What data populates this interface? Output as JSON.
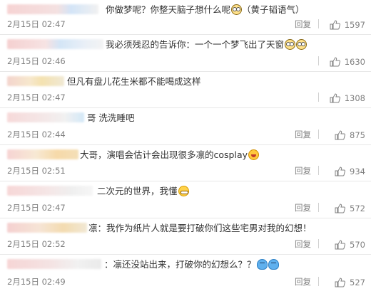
{
  "comments": [
    {
      "text": "你做梦呢？你整天脑子想什么呢",
      "emojis": [
        "glasses-face-icon"
      ],
      "suffix": "（黄子韬语气）",
      "time": "2月15日 02:47",
      "reply": "回复",
      "likes": "1597"
    },
    {
      "text": "我必须残忍的告诉你：一个一个梦飞出了天窗",
      "emojis": [
        "glasses-face-icon",
        "glasses-face-icon"
      ],
      "suffix": "",
      "time": "2月15日 02:46",
      "reply": "回复",
      "likes": "1630"
    },
    {
      "text": "但凡有盘儿花生米都不能喝成这样",
      "emojis": [],
      "suffix": "",
      "time": "2月15日 02:47",
      "reply": "回复",
      "likes": "1308"
    },
    {
      "text": "哥 洗洗睡吧",
      "emojis": [],
      "suffix": "",
      "time": "2月15日 02:44",
      "reply": "回复",
      "likes": "875"
    },
    {
      "text": "大哥，演唱会估计会出现很多凛的cosplay",
      "emojis": [
        "laugh-face-icon"
      ],
      "suffix": "",
      "time": "2月15日 02:51",
      "reply": "回复",
      "likes": "934"
    },
    {
      "text": "二次元的世界，我懂",
      "emojis": [
        "grin-face-icon"
      ],
      "suffix": "",
      "time": "2月15日 02:47",
      "reply": "回复",
      "likes": "572"
    },
    {
      "text": "凛：我作为纸片人就是要打破你们这些宅男对我的幻想！",
      "emojis": [],
      "suffix": "",
      "time": "2月15日 02:52",
      "reply": "回复",
      "likes": "570"
    },
    {
      "text": "：凛还没站出来，打破你的幻想么？？",
      "emojis": [
        "dunno-face-icon",
        "dunno-face-icon"
      ],
      "suffix": "",
      "time": "2月15日 02:49",
      "reply": "回复",
      "likes": "527"
    }
  ]
}
